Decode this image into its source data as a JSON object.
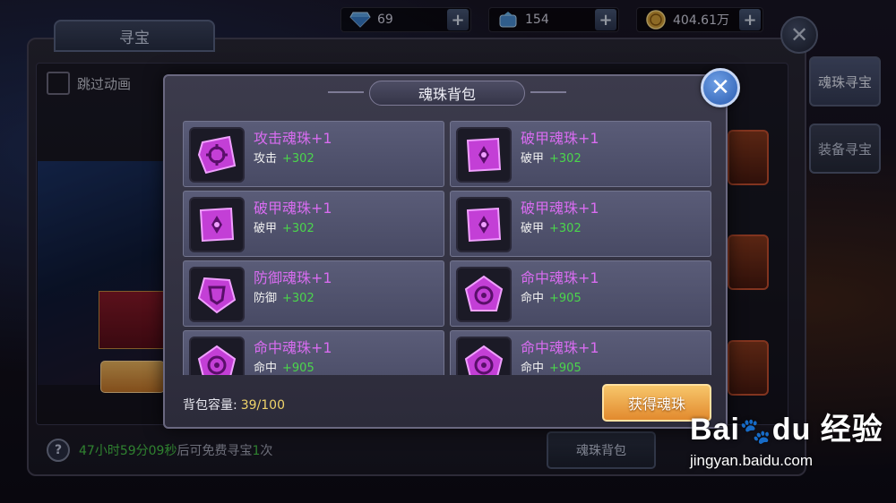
{
  "currencies": [
    {
      "icon": "diamond-icon",
      "value": "69"
    },
    {
      "icon": "gem-bag-icon",
      "value": "154"
    },
    {
      "icon": "coin-icon",
      "value": "404.61万"
    }
  ],
  "background": {
    "title": "寻宝",
    "skip_animation": "跳过动画",
    "side_tabs": [
      "魂珠寻宝",
      "装备寻宝"
    ],
    "timer": {
      "time": "47小时59分09秒",
      "suffix": "后可免费寻宝",
      "count": "1",
      "unit": "次"
    },
    "bottom_button": "魂珠背包"
  },
  "modal": {
    "title": "魂珠背包",
    "items": [
      {
        "name": "攻击魂珠+1",
        "stat_label": "攻击",
        "stat_value": "+302",
        "icon": "attack-orb-icon"
      },
      {
        "name": "破甲魂珠+1",
        "stat_label": "破甲",
        "stat_value": "+302",
        "icon": "armor-break-orb-icon"
      },
      {
        "name": "破甲魂珠+1",
        "stat_label": "破甲",
        "stat_value": "+302",
        "icon": "armor-break-orb-icon"
      },
      {
        "name": "破甲魂珠+1",
        "stat_label": "破甲",
        "stat_value": "+302",
        "icon": "armor-break-orb-icon"
      },
      {
        "name": "防御魂珠+1",
        "stat_label": "防御",
        "stat_value": "+302",
        "icon": "defense-orb-icon"
      },
      {
        "name": "命中魂珠+1",
        "stat_label": "命中",
        "stat_value": "+905",
        "icon": "hit-orb-icon"
      },
      {
        "name": "命中魂珠+1",
        "stat_label": "命中",
        "stat_value": "+905",
        "icon": "hit-orb-icon"
      },
      {
        "name": "命中魂珠+1",
        "stat_label": "命中",
        "stat_value": "+905",
        "icon": "hit-orb-icon"
      }
    ],
    "capacity_label": "背包容量:",
    "capacity_value": "39/100",
    "get_button": "获得魂珠"
  },
  "watermark": {
    "brand": "Bai",
    "brand2": "du",
    "brand3": "经验",
    "url": "jingyan.baidu.com"
  },
  "colors": {
    "item_name": "#d86cf0",
    "stat_value": "#4bd64b",
    "accent_button": "#e28a2e",
    "close_button": "#2a5cb0"
  }
}
